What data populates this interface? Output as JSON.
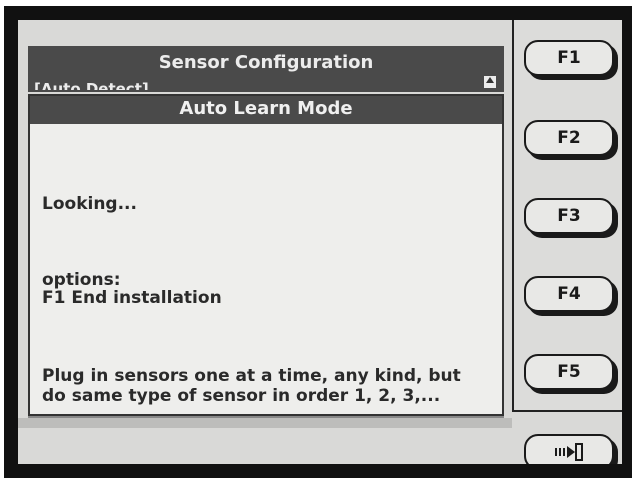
{
  "header": {
    "title": "Sensor Configuration",
    "subtitle": "[Auto Detect]"
  },
  "dialog": {
    "title": "Auto Learn Mode",
    "status": "Looking...",
    "options_label": "options:",
    "option_f1": "F1  End installation",
    "instruction_line1": "Plug in sensors one at a time, any kind, but",
    "instruction_line2": "do same type of sensor in order 1, 2, 3,..."
  },
  "function_keys": [
    "F1",
    "F2",
    "F3",
    "F4",
    "F5"
  ],
  "exit_key": {
    "icon": "exit-door-icon"
  },
  "colors": {
    "title_bar": "#4a4a4a",
    "screen_bg": "#d9d9d7",
    "dialog_bg": "#eeeeec",
    "text": "#2a2a2a"
  }
}
